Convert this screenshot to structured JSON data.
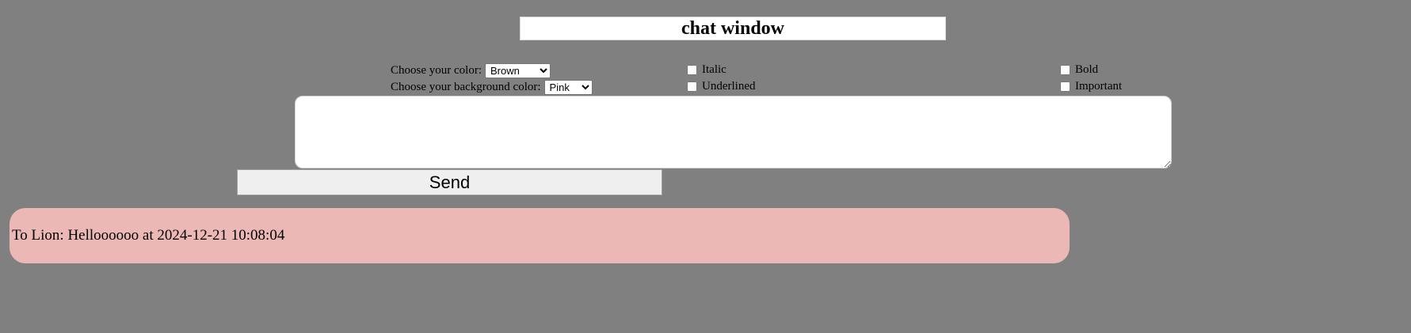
{
  "header": {
    "title": "chat window"
  },
  "controls": {
    "color_label": "Choose your color:",
    "color_selected": "Brown",
    "background_label": "Choose your background color:",
    "background_selected": "Pink",
    "italic_label": "Italic",
    "underlined_label": "Underlined",
    "bold_label": "Bold",
    "important_label": "Important"
  },
  "composer": {
    "message_value": "",
    "send_label": "Send"
  },
  "messages": [
    {
      "text": "To Lion: Helloooooo at 2024-12-21 10:08:04",
      "bubble_color": "#ebb8b5"
    }
  ],
  "colors": {
    "page_background": "#808080",
    "panel_white": "#ffffff",
    "button_background": "#efefef"
  }
}
